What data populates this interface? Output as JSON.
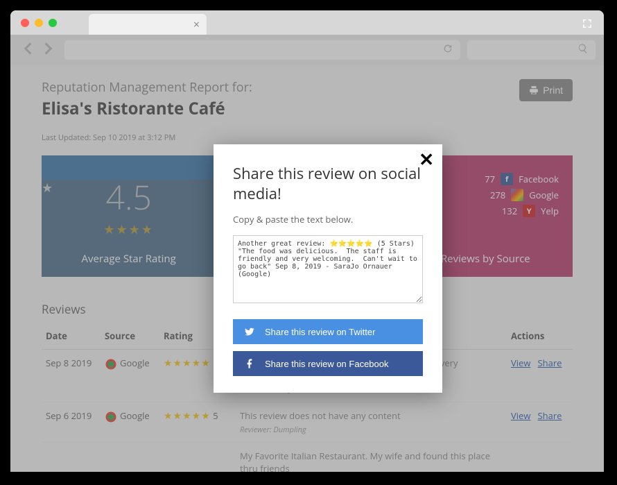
{
  "header": {
    "sup": "Reputation Management Report for:",
    "title": "Elisa's Ristorante Café",
    "print": "Print",
    "updated": "Last Updated: Sep 10 2019 at 3:12 PM"
  },
  "cards": {
    "rating": {
      "value": "4.5",
      "label": "Average Star Rating"
    },
    "sources": {
      "label": "Reviews by Source",
      "items": [
        {
          "count": "77",
          "name": "Facebook",
          "icon": "facebook"
        },
        {
          "count": "278",
          "name": "Google",
          "icon": "google"
        },
        {
          "count": "132",
          "name": "Yelp",
          "icon": "yelp"
        }
      ]
    }
  },
  "reviews": {
    "heading": "Reviews",
    "cols": {
      "date": "Date",
      "source": "Source",
      "rating": "Rating",
      "actions": "Actions"
    },
    "rows": [
      {
        "date": "Sep 8 2019",
        "source": "Google",
        "rating": "5",
        "content": "The food was delicious. The staff is friendly and very welcoming. Can't wait to go back",
        "reviewer": "SaraJo Ornauer"
      },
      {
        "date": "Sep 6 2019",
        "source": "Google",
        "rating": "5",
        "content": "This review does not have any content",
        "reviewer": "Dumpling"
      },
      {
        "date": "",
        "source": "",
        "rating": "",
        "content": "My Favorite Italian Restaurant. My wife and found this place thru friends",
        "reviewer": ""
      }
    ],
    "reviewer_label": "Reviewer:",
    "view": "View",
    "share": "Share"
  },
  "modal": {
    "title": "Share this review on social media!",
    "sub": "Copy & paste the text below.",
    "text": "Another great review: ⭐⭐⭐⭐⭐ (5 Stars) \"The food was delicious.  The staff is friendly and very welcoming.  Can't wait to go back\" Sep 8, 2019 - SaraJo Ornauer (Google)",
    "twitter": "Share this review on Twitter",
    "facebook": "Share this review on Facebook"
  }
}
